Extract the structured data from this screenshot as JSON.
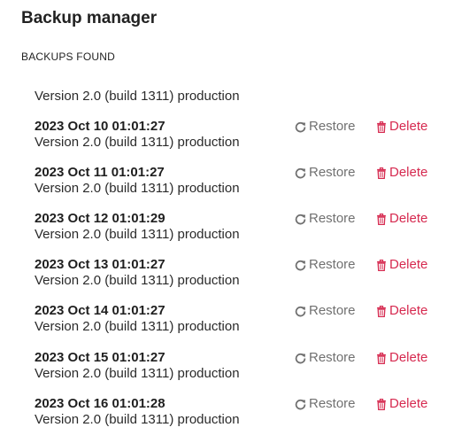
{
  "app": {
    "title": "Backup manager",
    "section_label": "BACKUPS FOUND"
  },
  "colors": {
    "restore": "#707070",
    "delete": "#d6294f",
    "text": "#1f1f1f"
  },
  "icons": {
    "restore": "refresh-icon",
    "delete": "trash-icon"
  },
  "current": {
    "version": "Version 2.0 (build 1311) production"
  },
  "backups": [
    {
      "date": "2023 Oct 10 01:01:27",
      "version": "Version 2.0 (build 1311) production",
      "restore_label": "Restore",
      "delete_label": "Delete"
    },
    {
      "date": "2023 Oct 11 01:01:27",
      "version": "Version 2.0 (build 1311) production",
      "restore_label": "Restore",
      "delete_label": "Delete"
    },
    {
      "date": "2023 Oct 12 01:01:29",
      "version": "Version 2.0 (build 1311) production",
      "restore_label": "Restore",
      "delete_label": "Delete"
    },
    {
      "date": "2023 Oct 13 01:01:27",
      "version": "Version 2.0 (build 1311) production",
      "restore_label": "Restore",
      "delete_label": "Delete"
    },
    {
      "date": "2023 Oct 14 01:01:27",
      "version": "Version 2.0 (build 1311) production",
      "restore_label": "Restore",
      "delete_label": "Delete"
    },
    {
      "date": "2023 Oct 15 01:01:27",
      "version": "Version 2.0 (build 1311) production",
      "restore_label": "Restore",
      "delete_label": "Delete"
    },
    {
      "date": "2023 Oct 16 01:01:28",
      "version": "Version 2.0 (build 1311) production",
      "restore_label": "Restore",
      "delete_label": "Delete"
    }
  ]
}
